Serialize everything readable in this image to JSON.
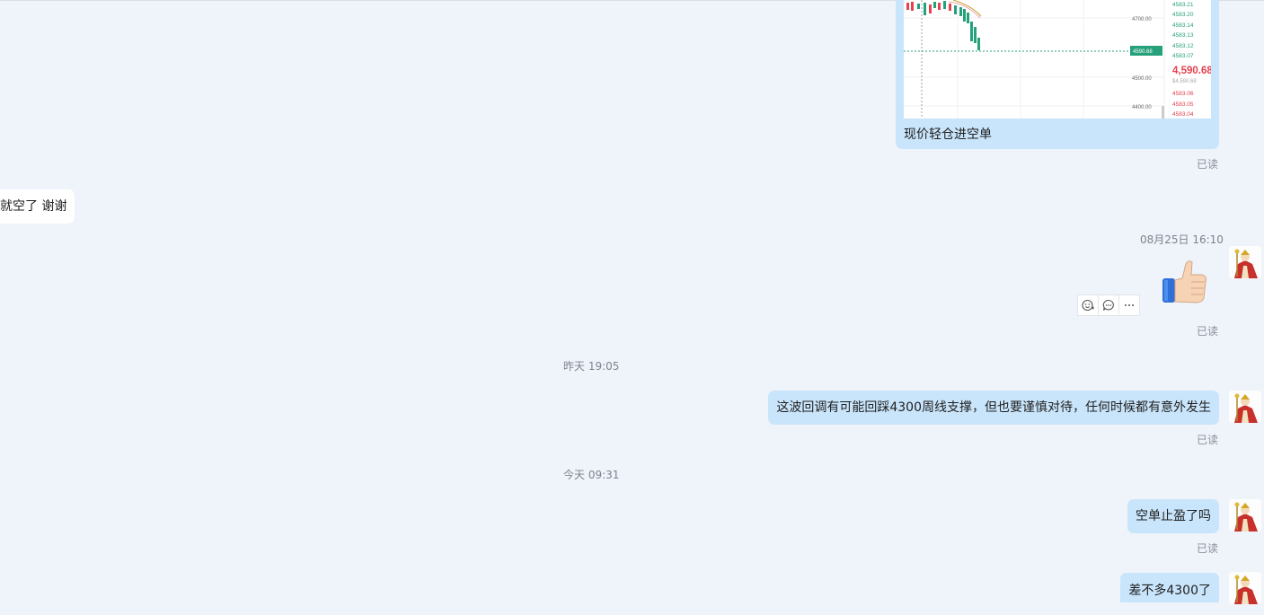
{
  "messages": {
    "image_msg": {
      "caption": "现价轻仓进空单",
      "read": "已读",
      "chart_prices_top": [
        "4583.21",
        "4583.20",
        "4583.14",
        "4583.13",
        "4583.12",
        "4583.07"
      ],
      "chart_axis": [
        "4700.00",
        "4500.00",
        "4400.00"
      ],
      "chart_current_tag": "4590.68",
      "chart_big_price": "4,590.68",
      "chart_sub_price": "$4,590.68",
      "chart_prices_bottom": [
        "4583.06",
        "4583.05",
        "4583.04"
      ]
    },
    "incoming_1": {
      "text": "就空了  谢谢"
    },
    "timestamp_1": "08月25日 16:10",
    "thumbs_msg": {
      "read": "已读"
    },
    "timestamp_2": "昨天 19:05",
    "outgoing_2": {
      "text": "这波回调有可能回踩4300周线支撑，但也要谨慎对待，任何时候都有意外发生",
      "read": "已读"
    },
    "timestamp_3": "今天 09:31",
    "outgoing_3": {
      "text": "空单止盈了吗",
      "read": "已读"
    },
    "outgoing_4": {
      "text": "差不多4300了"
    }
  },
  "icons": [
    "emoji-react-icon",
    "comment-icon",
    "more-icon",
    "thumbs-up-emoji-icon"
  ],
  "colors": {
    "background": "#eff3fa",
    "bubble_mine": "#c9e5fb",
    "bubble_other": "#ffffff",
    "candle_down": "#26a17b",
    "candle_up": "#e5414e"
  }
}
